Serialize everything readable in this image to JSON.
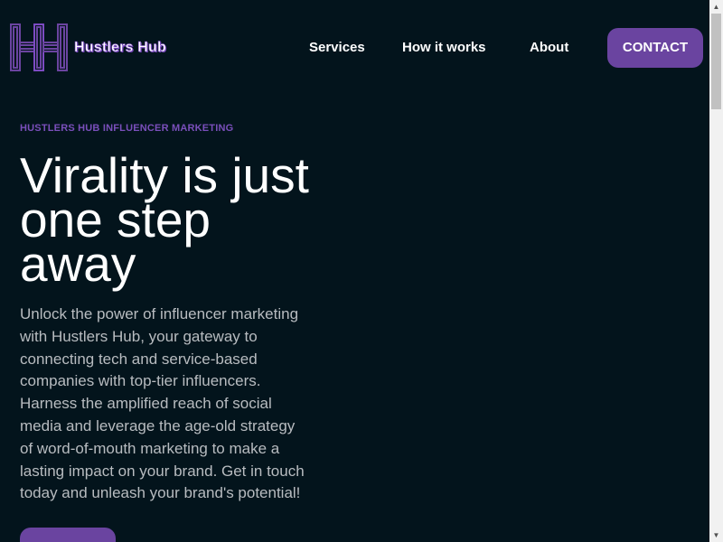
{
  "brand": {
    "name": "Hustlers Hub",
    "accent_color": "#6a44a0",
    "background_color": "#03141c"
  },
  "nav": {
    "items": [
      {
        "label": "Services"
      },
      {
        "label": "How it works"
      },
      {
        "label": "About"
      }
    ],
    "contact_label": "CONTACT"
  },
  "hero": {
    "eyebrow": "HUSTLERS HUB INFLUENCER MARKETING",
    "title": "Virality is just one step away",
    "body": "Unlock the power of influencer marketing with Hustlers Hub, your gateway to connecting tech and service-based companies with top-tier influencers. Harness the amplified reach of social media and leverage the age-old strategy of word-of-mouth marketing to make a lasting impact on your brand. Get in touch today and unleash your brand's potential!"
  },
  "scrollbar": {
    "up_icon": "triangle-up-icon",
    "down_icon": "triangle-down-icon"
  }
}
